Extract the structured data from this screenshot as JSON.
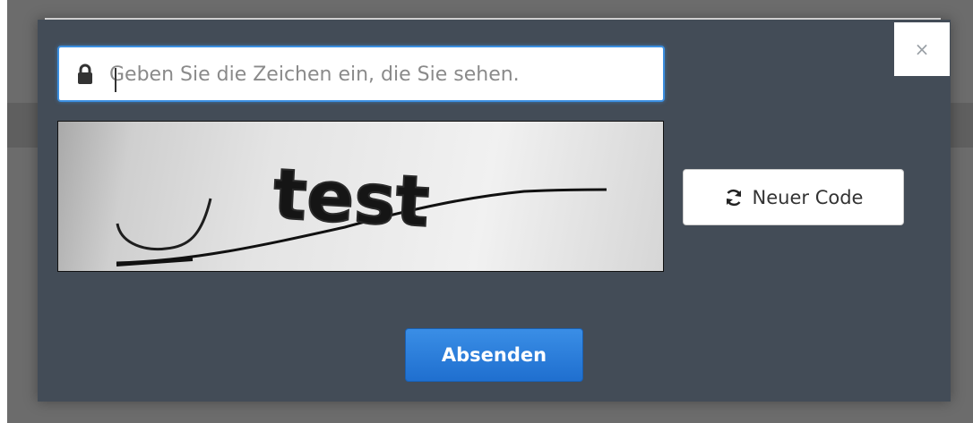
{
  "captcha_dialog": {
    "close_label": "×",
    "input": {
      "value": "",
      "placeholder": "Geben Sie die Zeichen ein, die Sie sehen."
    },
    "captcha_image": {
      "text": "test"
    },
    "refresh_button": {
      "icon": "refresh-icon",
      "label": "Neuer Code"
    },
    "submit_button": {
      "label": "Absenden"
    },
    "colors": {
      "modal_background": "#434c57",
      "input_focus_border": "#3c8fe0",
      "submit_background": "#2a7fdc"
    }
  }
}
